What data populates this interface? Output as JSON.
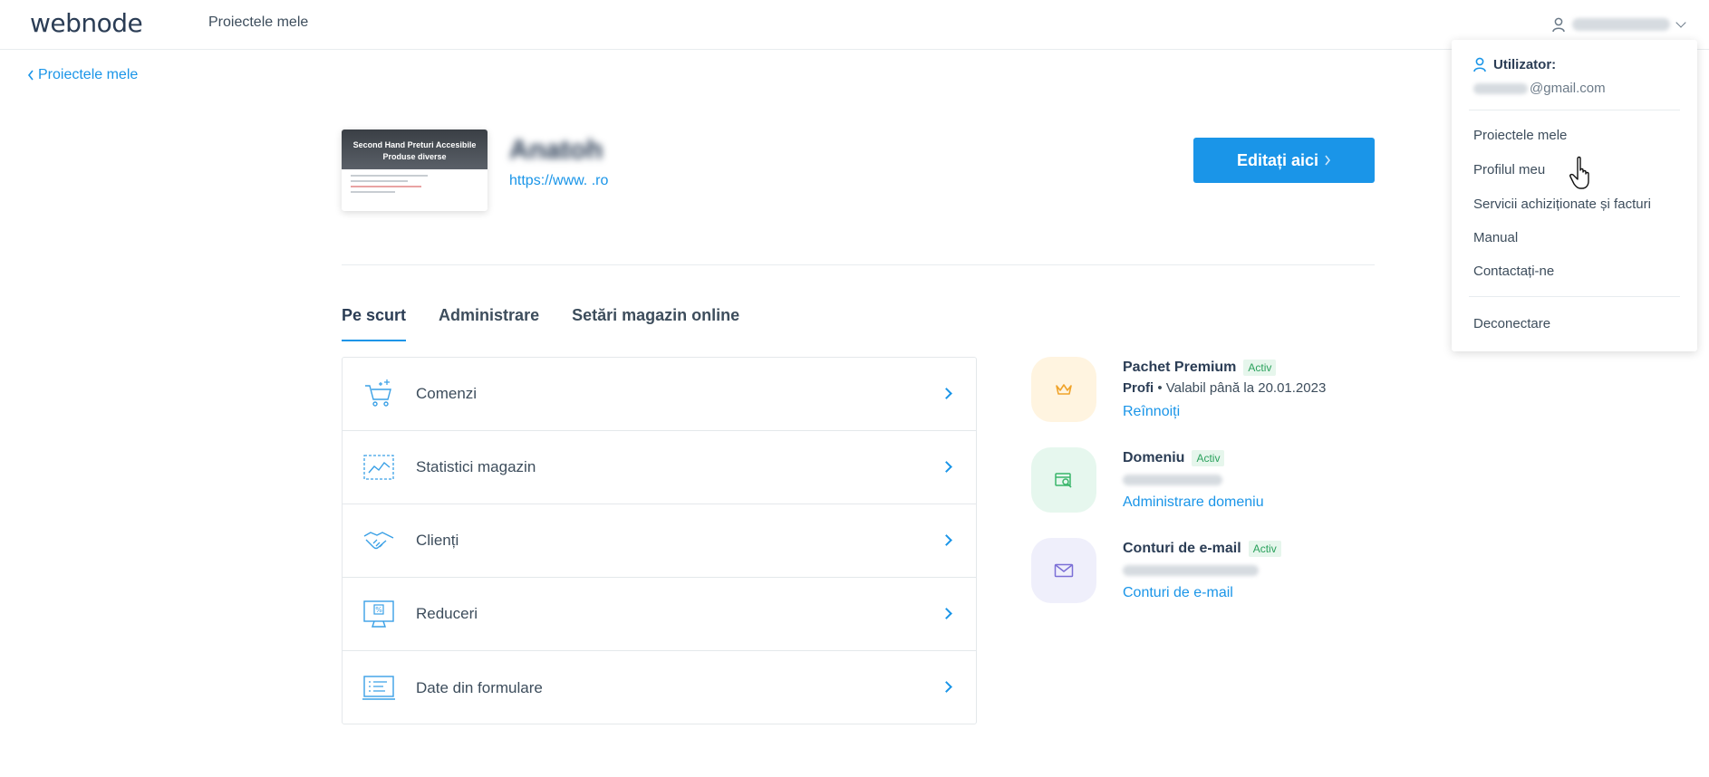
{
  "header": {
    "logo": "webnode",
    "nav_projects": "Proiectele mele"
  },
  "back_link": "Proiectele mele",
  "project": {
    "thumbnail_title_line1": "Second Hand Preturi Accesibile",
    "thumbnail_title_line2": "Produse diverse",
    "name": "Anatoh",
    "url": "https://www.        .ro",
    "edit_button": "Editați aici"
  },
  "tabs": [
    {
      "label": "Pe scurt",
      "active": true
    },
    {
      "label": "Administrare",
      "active": false
    },
    {
      "label": "Setări magazin online",
      "active": false
    }
  ],
  "list": [
    {
      "label": "Comenzi",
      "icon": "cart-icon"
    },
    {
      "label": "Statistici magazin",
      "icon": "chart-icon"
    },
    {
      "label": "Clienți",
      "icon": "handshake-icon"
    },
    {
      "label": "Reduceri",
      "icon": "discount-monitor-icon"
    },
    {
      "label": "Date din formulare",
      "icon": "form-data-icon"
    }
  ],
  "info": {
    "package": {
      "title": "Pachet Premium",
      "badge": "Activ",
      "plan": "Profi",
      "validity": " • Valabil până la 20.01.2023",
      "link": "Reînnoiți",
      "icon": "crown-icon",
      "color": "#fff4e0"
    },
    "domain": {
      "title": "Domeniu",
      "badge": "Activ",
      "link": "Administrare domeniu",
      "icon": "domain-search-icon",
      "color": "#e6f7ee"
    },
    "email": {
      "title": "Conturi de e-mail",
      "badge": "Activ",
      "link": "Conturi de e-mail",
      "icon": "mail-icon",
      "color": "#efeffb"
    }
  },
  "dropdown": {
    "user_label": "Utilizator:",
    "email_suffix": "@gmail.com",
    "items": [
      "Proiectele mele",
      "Profilul meu",
      "Servicii achiziționate și facturi",
      "Manual",
      "Contactați-ne"
    ],
    "logout": "Deconectare"
  },
  "colors": {
    "accent": "#1a95e8",
    "text": "#3d4d5c",
    "active_badge": "#2aa15c"
  }
}
